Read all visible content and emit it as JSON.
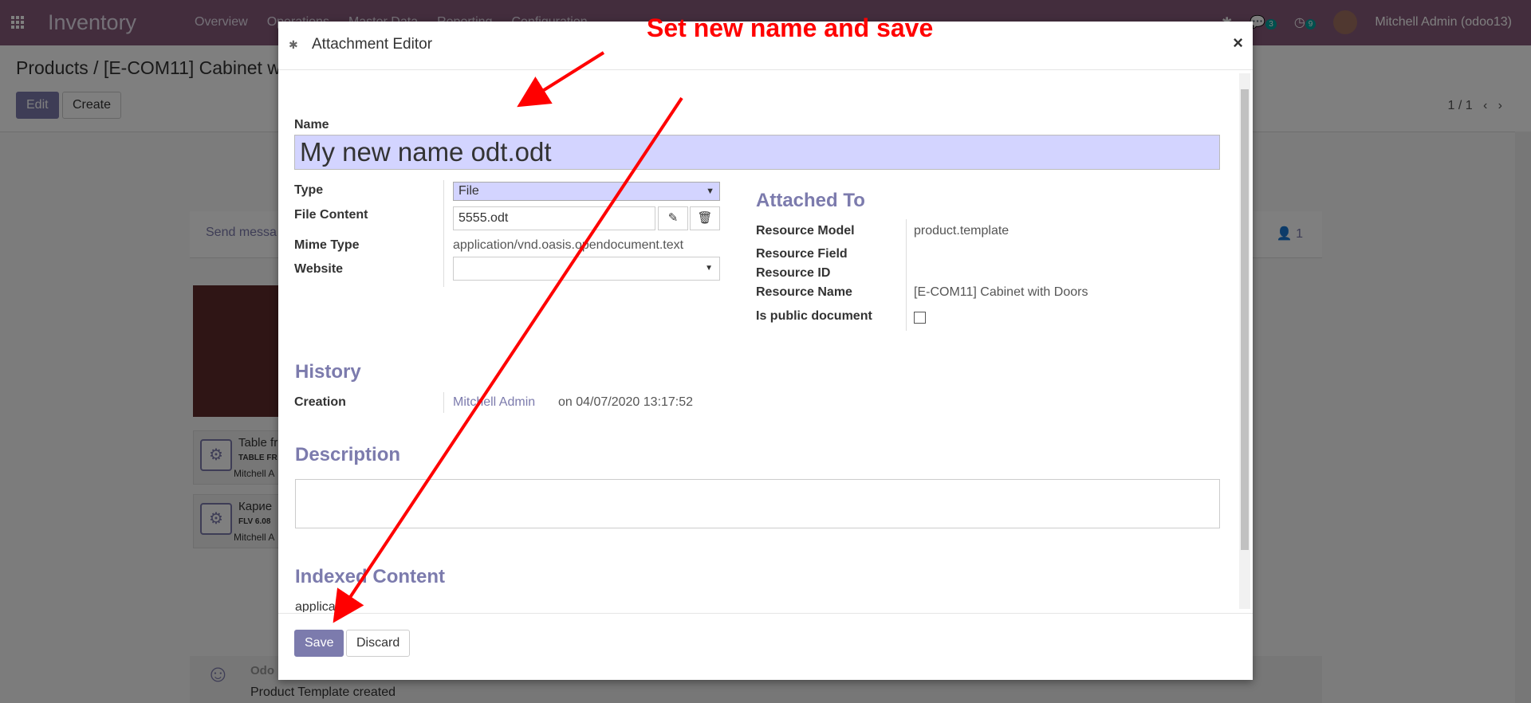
{
  "app": {
    "title": "Inventory",
    "menu": [
      "Overview",
      "Operations",
      "Master Data",
      "Reporting",
      "Configuration"
    ],
    "user": "Mitchell Admin (odoo13)",
    "badges": {
      "messages": "3",
      "activities": "9"
    }
  },
  "control_panel": {
    "breadcrumb": "Products / [E-COM11] Cabinet w",
    "edit_label": "Edit",
    "create_label": "Create",
    "pager": "1 / 1"
  },
  "chatter": {
    "send_message": "Send messa",
    "followers": "1",
    "attachments": [
      {
        "name": "Table fr",
        "meta": "TABLE FR",
        "author": "Mitchell A"
      },
      {
        "name": "Карие",
        "meta": "FLV 6.08",
        "author": "Mitchell A"
      }
    ],
    "last_message_author": "Odo",
    "last_message": "Product Template created"
  },
  "modal": {
    "title": "Attachment Editor",
    "name_label": "Name",
    "name_value": "My new name odt.odt",
    "type_label": "Type",
    "type_value": "File",
    "file_content_label": "File Content",
    "file_content_value": "5555.odt",
    "mime_type_label": "Mime Type",
    "mime_type_value": "application/vnd.oasis.opendocument.text",
    "website_label": "Website",
    "website_value": "",
    "attached_to_title": "Attached To",
    "resource_model_label": "Resource Model",
    "resource_model_value": "product.template",
    "resource_field_label": "Resource Field",
    "resource_id_label": "Resource ID",
    "resource_name_label": "Resource Name",
    "resource_name_value": "[E-COM11] Cabinet with Doors",
    "is_public_label": "Is public document",
    "history_title": "History",
    "creation_label": "Creation",
    "creation_author": "Mitchell Admin",
    "creation_date": "on 04/07/2020 13:17:52",
    "description_title": "Description",
    "indexed_content_title": "Indexed Content",
    "indexed_content_preview": "applica",
    "save_label": "Save",
    "discard_label": "Discard"
  },
  "annotation": {
    "callout": "Set new name and save",
    "color": "#ff0000"
  }
}
